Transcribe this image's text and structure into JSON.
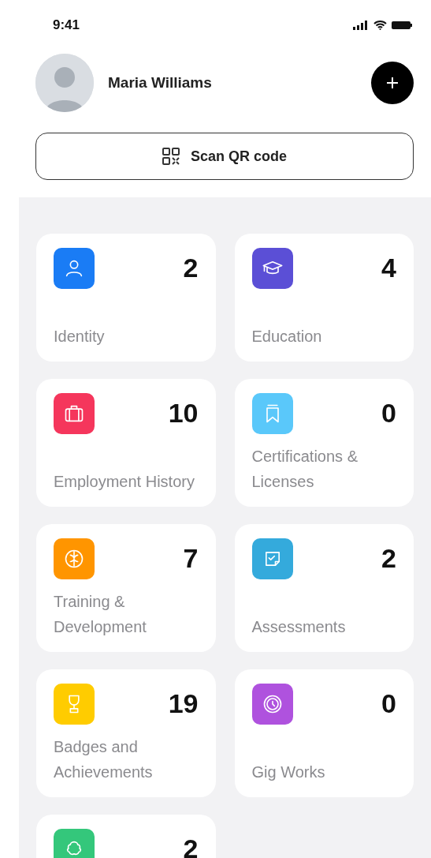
{
  "status_bar": {
    "time": "9:41"
  },
  "profile": {
    "name": "Maria Williams"
  },
  "scan_button": {
    "label": "Scan QR code"
  },
  "categories": [
    {
      "label": "Identity",
      "count": "2",
      "color": "#1a7cf5"
    },
    {
      "label": "Education",
      "count": "4",
      "color": "#5b4fd6"
    },
    {
      "label": "Employment History",
      "count": "10",
      "color": "#f5365c"
    },
    {
      "label": "Certifications & Licenses",
      "count": "0",
      "color": "#5ac8fa"
    },
    {
      "label": "Training & Development",
      "count": "7",
      "color": "#ff9500"
    },
    {
      "label": "Assessments",
      "count": "2",
      "color": "#34aadc"
    },
    {
      "label": "Badges and Achievements",
      "count": "19",
      "color": "#ffcc00"
    },
    {
      "label": "Gig Works",
      "count": "0",
      "color": "#af52de"
    },
    {
      "count": "2",
      "color": "#34c77b"
    }
  ]
}
